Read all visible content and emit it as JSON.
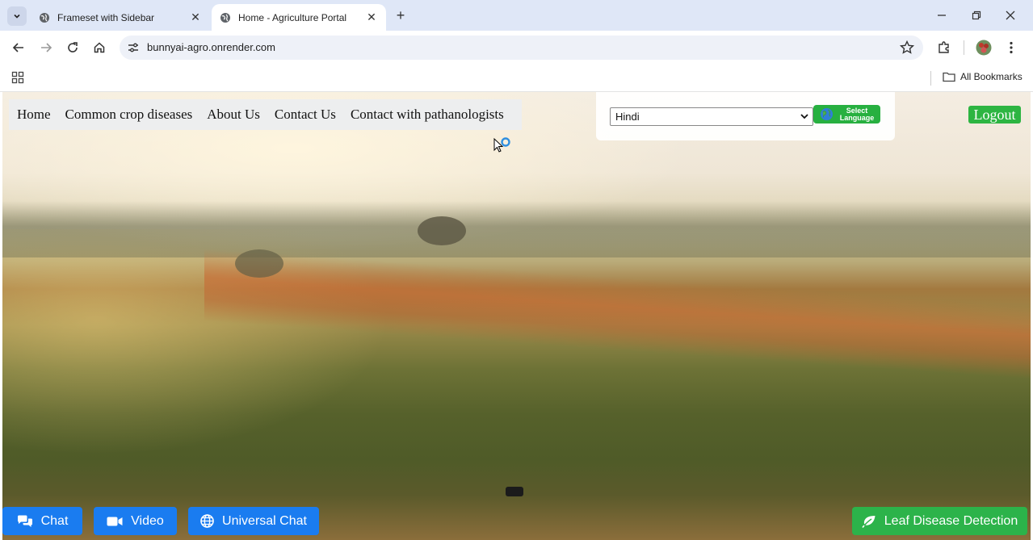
{
  "browser": {
    "tabs": [
      {
        "title": "Frameset with Sidebar",
        "active": false
      },
      {
        "title": "Home - Agriculture Portal",
        "active": true
      }
    ],
    "url": "bunnyai-agro.onrender.com",
    "bookmarks_label": "All Bookmarks"
  },
  "nav": {
    "items": [
      "Home",
      "Common crop diseases",
      "About Us",
      "Contact Us",
      "Contact with pathanologists"
    ]
  },
  "language": {
    "selected": "Hindi",
    "button_line1": "Select",
    "button_line2": "Language"
  },
  "logout_label": "Logout",
  "bottom": {
    "chat": "Chat",
    "video": "Video",
    "universal_chat": "Universal Chat",
    "leaf_detection": "Leaf Disease Detection"
  },
  "colors": {
    "accent_blue": "#1a7cf0",
    "accent_green": "#2cb34a"
  }
}
